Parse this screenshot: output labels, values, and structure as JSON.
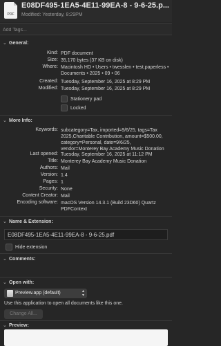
{
  "header": {
    "file_icon_label": "PDF",
    "file_title": "E08DF495-1EA5-4E11-99EA-8 - 9-6-25.p...",
    "modified": "Modified: Yesterday, 8:29PM"
  },
  "tags": {
    "placeholder": "Add Tags..."
  },
  "general": {
    "title": "General:",
    "rows": [
      {
        "label": "Kind:",
        "value": "PDF document"
      },
      {
        "label": "Size:",
        "value": "35,170 bytes (37 KB on disk)"
      },
      {
        "label": "Where:",
        "value": "Macintosh HD • Users • twesslen • test.paperless • Documents • 2025 • 09 • 06"
      },
      {
        "label": "Created:",
        "value": "Tuesday, September 16, 2025 at 8:29 PM"
      },
      {
        "label": "Modified:",
        "value": "Tuesday, September 16, 2025 at 8:29 PM"
      }
    ],
    "stationery": "Stationery pad",
    "locked": "Locked"
  },
  "more_info": {
    "title": "More Info:",
    "rows": [
      {
        "label": "Keywords:",
        "value": "subcategory=Tax, imported=9/6/25, tags=Tax 2025,Charitable Contribution, amount=$500.00, category=Personal, date=9/6/25, vendor=Monterey Bay Academy Music Donation"
      },
      {
        "label": "Last opened:",
        "value": "Tuesday, September 16, 2025 at 11:12 PM"
      },
      {
        "label": "Title:",
        "value": "Monterey Bay Academy Music Donation"
      },
      {
        "label": "Authors:",
        "value": "Mail"
      },
      {
        "label": "Version:",
        "value": "1.4"
      },
      {
        "label": "Pages:",
        "value": "1"
      },
      {
        "label": "Security:",
        "value": "None"
      },
      {
        "label": "Content Creator:",
        "value": "Mail"
      },
      {
        "label": "Encoding software:",
        "value": "macOS Version 14.3.1 (Build 23D60) Quartz PDFContext"
      }
    ]
  },
  "name_extension": {
    "title": "Name & Extension:",
    "filename": "E08DF495-1EA5-4E11-99EA-8 - 9-6-25.pdf",
    "hide_extension": "Hide extension"
  },
  "comments": {
    "title": "Comments:"
  },
  "open_with": {
    "title": "Open with:",
    "app": "Preview.app (default)",
    "description": "Use this application to open all documents like this one.",
    "change_all": "Change All..."
  },
  "preview": {
    "title": "Preview:"
  }
}
